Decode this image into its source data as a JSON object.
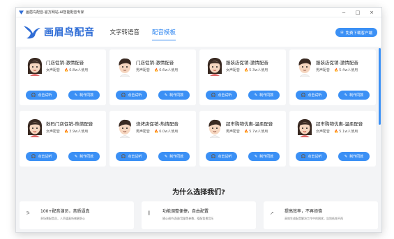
{
  "window": {
    "title": "画眉鸟配音-官方网站-AI智能配音专家",
    "minimize": "−",
    "maximize": "□",
    "close": "×"
  },
  "header": {
    "logo_text": "画眉鸟配音",
    "nav": [
      {
        "label": "文字转语音"
      },
      {
        "label": "配音模板"
      }
    ],
    "download_label": "免费下载客户端",
    "download_icon": "windows-icon"
  },
  "cards": [
    {
      "name": "门店促销-激情配音",
      "voice": "女声配音",
      "users": "6.8w人使用",
      "avatar": "female",
      "listen": "点击试听",
      "make": "制作同款"
    },
    {
      "name": "门店促销-激情配音",
      "voice": "男声配音",
      "users": "6.6w人使用",
      "avatar": "male",
      "listen": "点击试听",
      "make": "制作同款"
    },
    {
      "name": "服装店促销-激情配音",
      "voice": "女声配音",
      "users": "5.3w人使用",
      "avatar": "female",
      "listen": "点击试听",
      "make": "制作同款"
    },
    {
      "name": "服装店促销-激情配音",
      "voice": "男声配音",
      "users": "5.4w人使用",
      "avatar": "male",
      "listen": "点击试听",
      "make": "制作同款"
    },
    {
      "name": "数码门店促销-热情配音",
      "voice": "女声配音",
      "users": "3.9w人使用",
      "avatar": "female",
      "listen": "点击试听",
      "make": "制作同款"
    },
    {
      "name": "烧烤店促销-热情配音",
      "voice": "男声配音",
      "users": "6.0w人使用",
      "avatar": "male",
      "listen": "点击试听",
      "make": "制作同款"
    },
    {
      "name": "超市购物优惠-温柔配音",
      "voice": "男声配音",
      "users": "5.7w人使用",
      "avatar": "male",
      "listen": "点击试听",
      "make": "制作同款"
    },
    {
      "name": "超市购物优惠-温柔配音",
      "voice": "女声配音",
      "users": "5.1w人使用",
      "avatar": "female",
      "listen": "点击试听",
      "make": "制作同款"
    }
  ],
  "why_title": "为什么选择我们?",
  "features": [
    {
      "title": "100+配音演员，音质逼真",
      "desc": "多场景配音员，人声逼真听感更舒心",
      "icon": "mic-icon"
    },
    {
      "title": "功能调整便捷，自由配置",
      "desc": "随心调节语速/音量等参数，搭配背景音乐",
      "icon": "sliders-icon"
    },
    {
      "title": "提高效率，不再烦恼",
      "desc": "高效生成配音解决工作中的困扰，告别低效不再",
      "icon": "rocket-icon"
    }
  ],
  "colors": {
    "accent": "#3b90f5",
    "fire": "#e0422f"
  }
}
